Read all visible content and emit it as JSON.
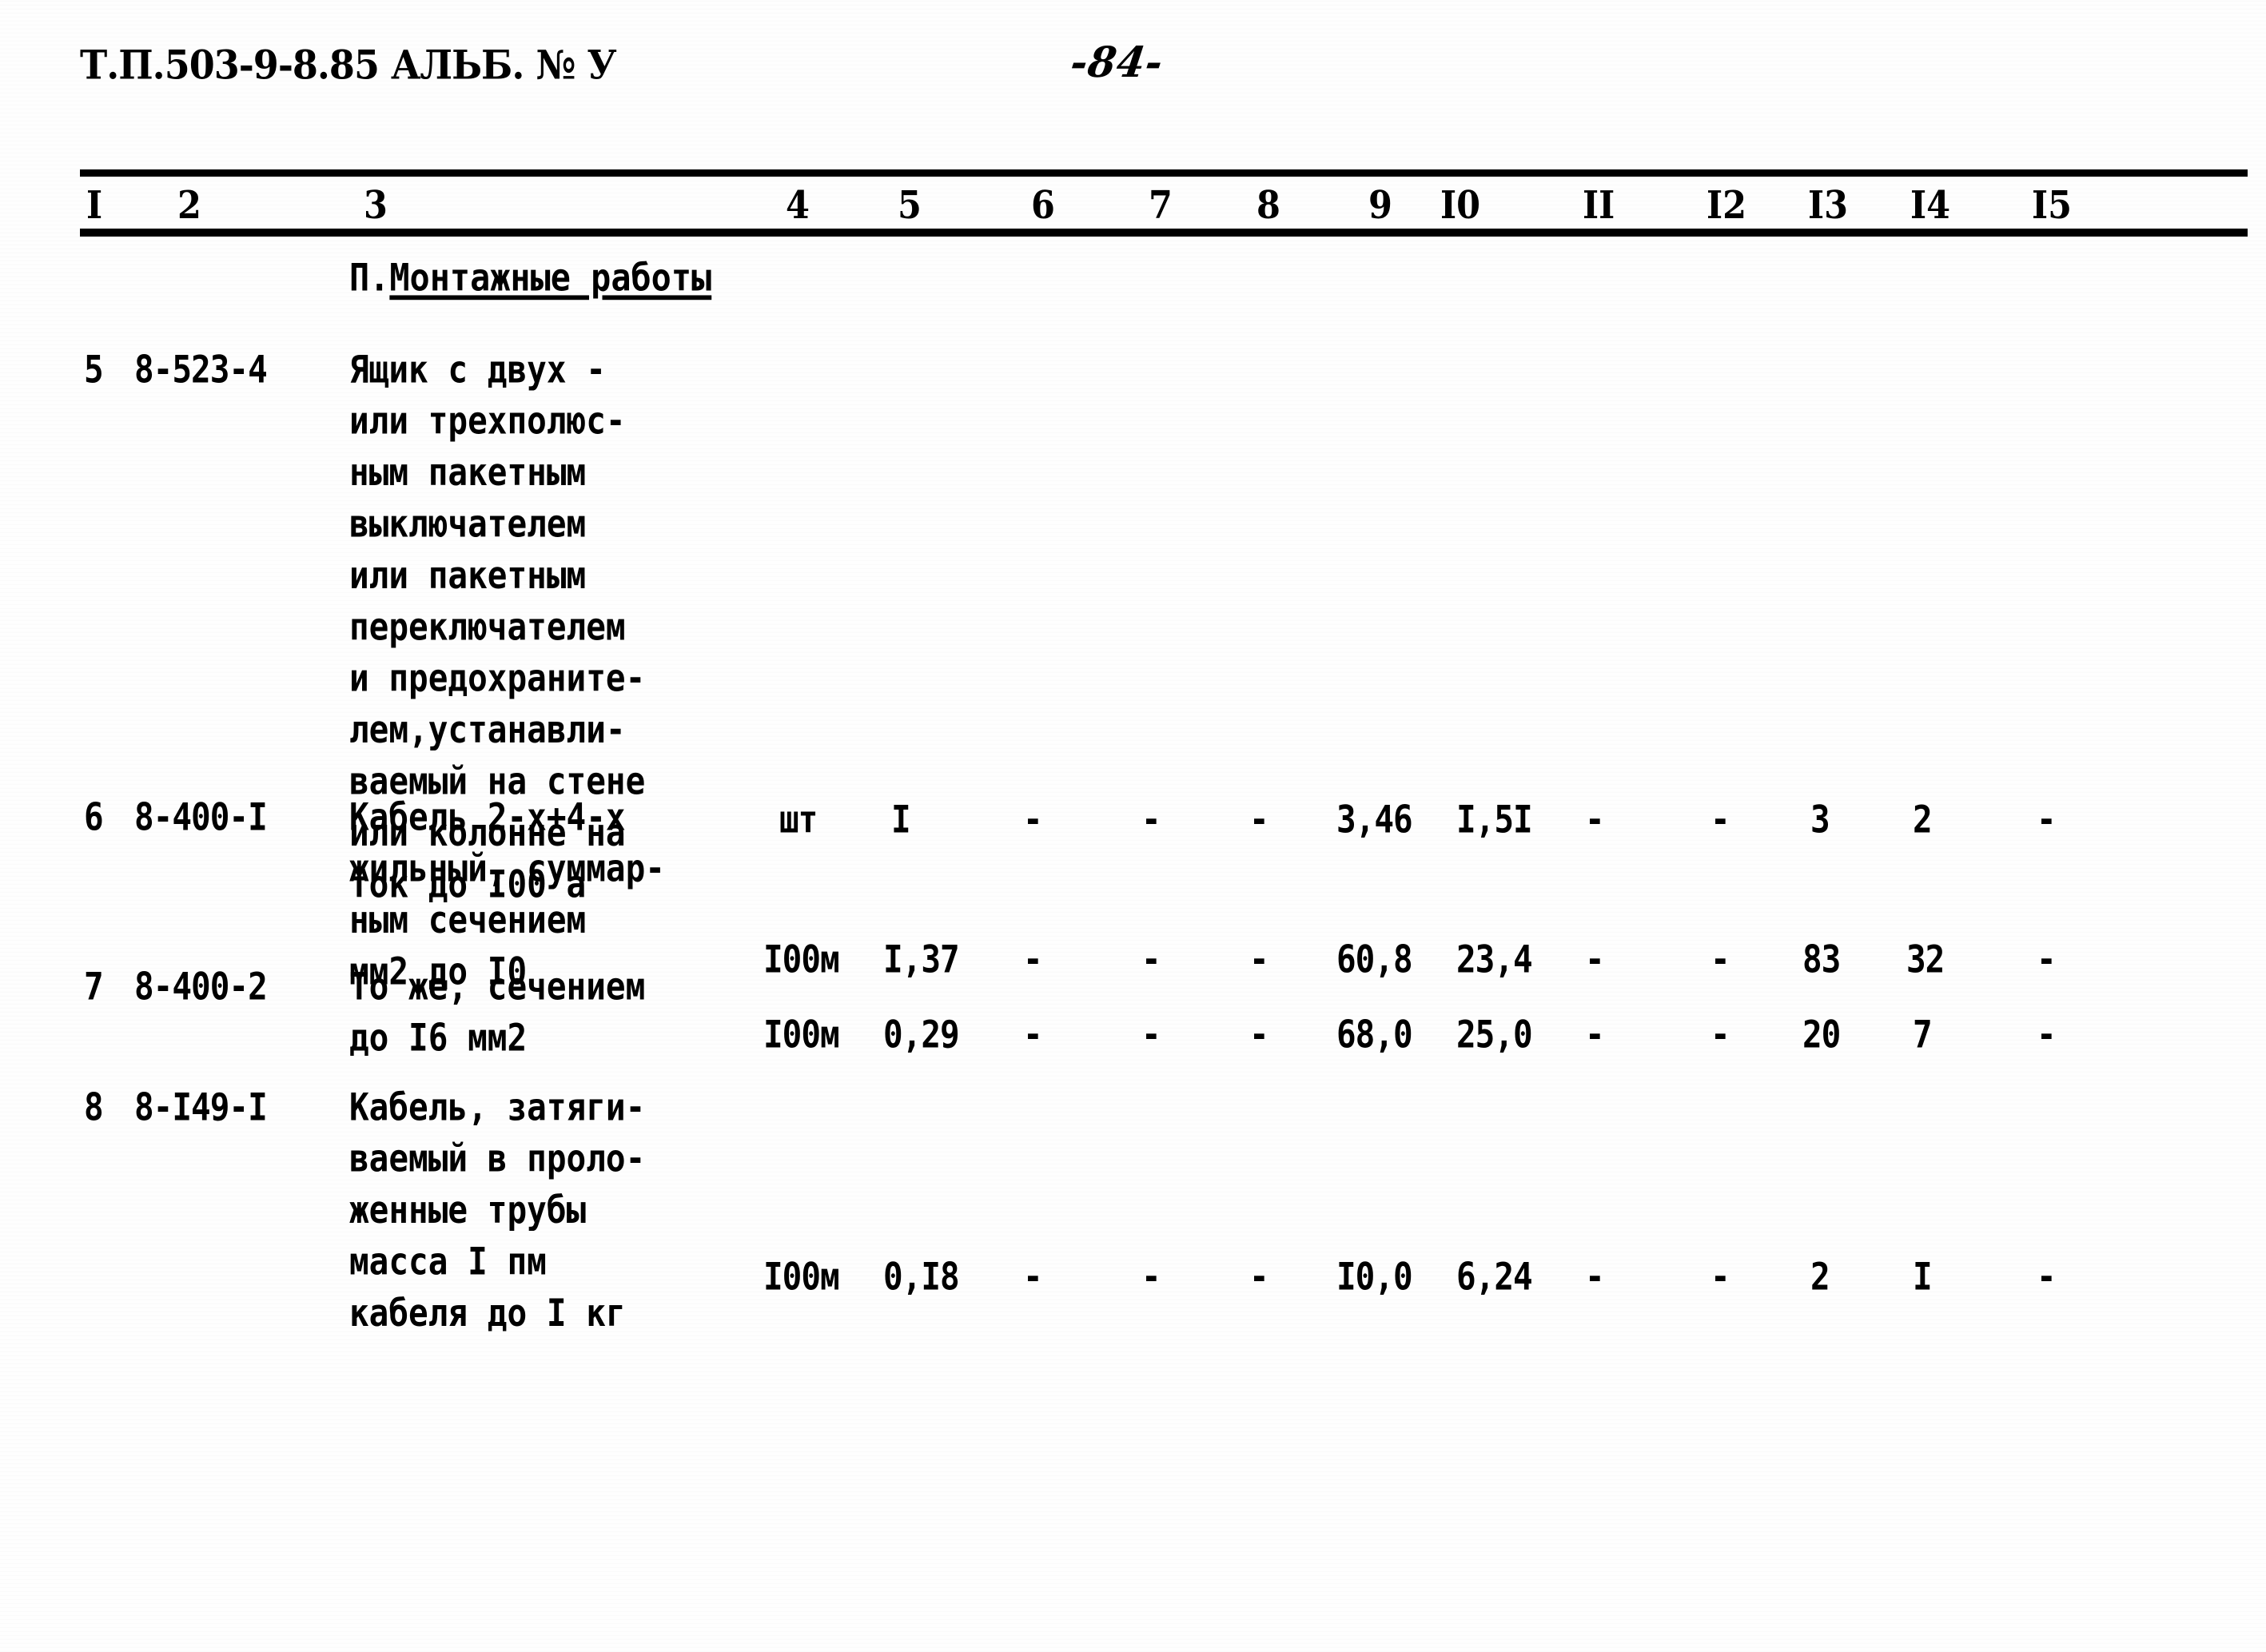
{
  "document": {
    "header_code": "Т.П.503-9-8.85 АЛЬБ. № У",
    "page_number": "-84-"
  },
  "table": {
    "column_headers": [
      "I",
      "2",
      "3",
      "4",
      "5",
      "6",
      "7",
      "8",
      "9",
      "I0",
      "II",
      "I2",
      "I3",
      "I4",
      "I5"
    ],
    "section_title_prefix": "П.",
    "section_title": "Монтажные работы",
    "rows": [
      {
        "index": "5",
        "code": "8-523-4",
        "description": "Ящик с двух -\nили трехполюс-\nным пакетным\nвыключателем\nили пакетным\nпереключателем\nи предохраните-\nлем,устанавли-\nваемый на стене\nили колонне на\nток до I00 а",
        "unit": "шт",
        "c5": "I",
        "c6": "-",
        "c7": "-",
        "c8": "-",
        "c9": "3,46",
        "c10": "I,5I",
        "c11": "-",
        "c12": "-",
        "c13": "3",
        "c14": "2",
        "c15": "-"
      },
      {
        "index": "6",
        "code": "8-400-I",
        "description": "Кабель 2-х+4-х\nжильный, суммар-\nным сечением\nмм2 до I0",
        "unit": "I00м",
        "c5": "I,37",
        "c6": "-",
        "c7": "-",
        "c8": "-",
        "c9": "60,8",
        "c10": "23,4",
        "c11": "-",
        "c12": "-",
        "c13": "83",
        "c14": "32",
        "c15": "-"
      },
      {
        "index": "7",
        "code": "8-400-2",
        "description": "То же, сечением\nдо I6 мм2",
        "unit": "I00м",
        "c5": "0,29",
        "c6": "-",
        "c7": "-",
        "c8": "-",
        "c9": "68,0",
        "c10": "25,0",
        "c11": "-",
        "c12": "-",
        "c13": "20",
        "c14": "7",
        "c15": "-"
      },
      {
        "index": "8",
        "code": "8-I49-I",
        "description": "Кабель, затяги-\nваемый в проло-\nженные трубы\nмасса I пм\nкабеля до I кг",
        "unit": "I00м",
        "c5": "0,I8",
        "c6": "-",
        "c7": "-",
        "c8": "-",
        "c9": "I0,0",
        "c10": "6,24",
        "c11": "-",
        "c12": "-",
        "c13": "2",
        "c14": "I",
        "c15": "-"
      }
    ]
  }
}
